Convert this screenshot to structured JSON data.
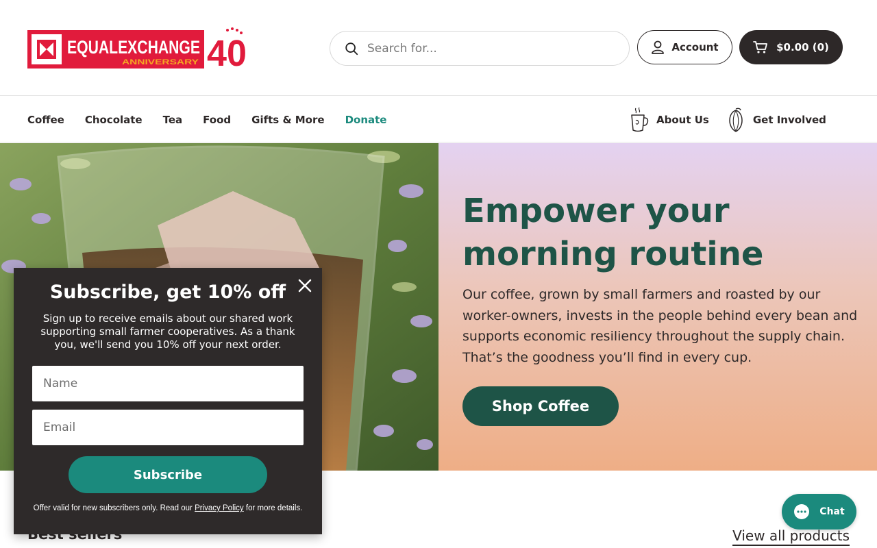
{
  "header": {
    "logo_main": "EQUALEXCHANGE",
    "logo_sub": "ANNIVERSARY",
    "logo_number": "40",
    "search_placeholder": "Search for...",
    "account_label": "Account",
    "cart_label": "$0.00 (0)"
  },
  "nav": {
    "items": [
      "Coffee",
      "Chocolate",
      "Tea",
      "Food",
      "Gifts & More",
      "Donate"
    ],
    "right_items": [
      "About Us",
      "Get Involved"
    ]
  },
  "hero": {
    "title": "Empower your morning routine",
    "body": "Our coffee, grown by small farmers and roasted by our worker-owners, invests in the people behind every bean and supports economic resiliency throughout the supply chain. That’s the goodness you’ll find in every cup.",
    "cta": "Shop Coffee"
  },
  "section": {
    "title": "Best sellers",
    "view_all": "View all products"
  },
  "chat": {
    "label": "Chat"
  },
  "popup": {
    "title": "Subscribe, get 10% off",
    "description": "Sign up to receive emails about our shared work supporting small farmer cooperatives. As a thank you, we'll send you 10% off your next order.",
    "name_placeholder": "Name",
    "email_placeholder": "Email",
    "subscribe_label": "Subscribe",
    "fine_prefix": "Offer valid for new subscribers only. Read our",
    "fine_link": "Privacy Policy",
    "fine_suffix": "for more details."
  },
  "colors": {
    "dark": "#2d2828",
    "brand_red": "#e11b3c",
    "brand_orange": "#f08a1c",
    "teal": "#1b8a7d",
    "hero_green": "#1e5447"
  }
}
